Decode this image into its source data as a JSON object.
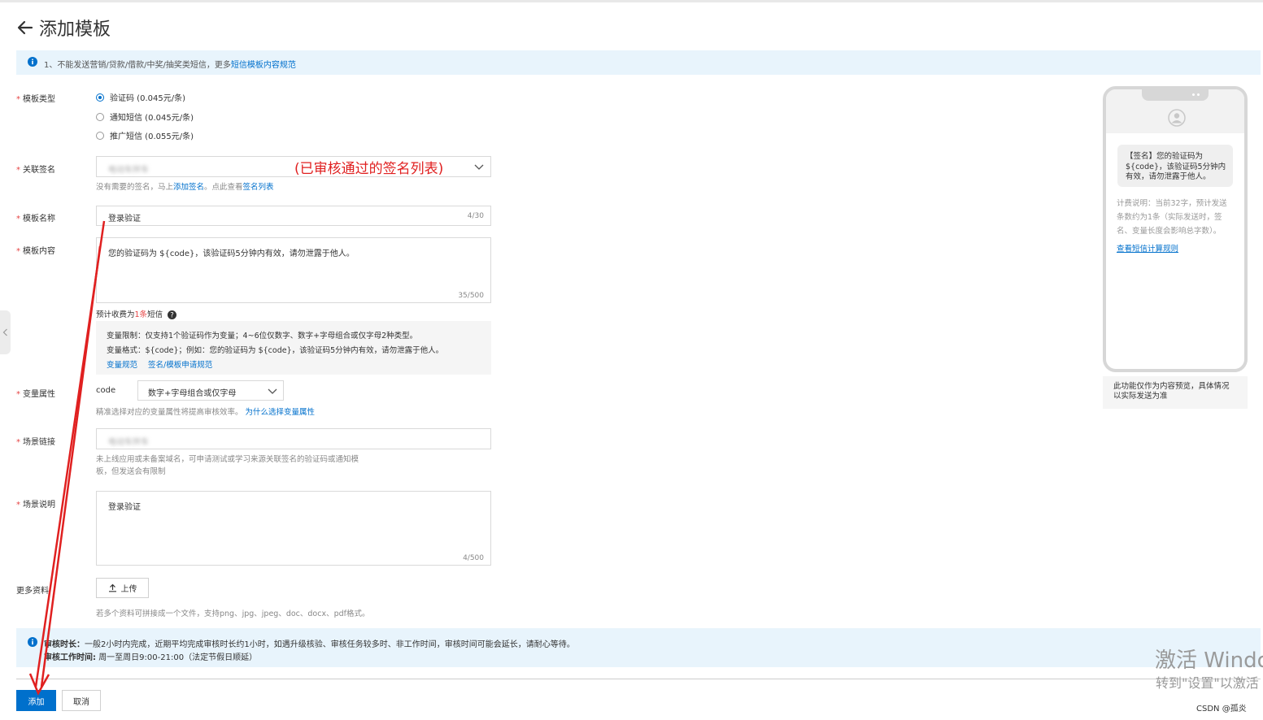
{
  "header": {
    "title": "添加模板"
  },
  "notice_top": {
    "text": "1、不能发送营销/贷款/借款/中奖/抽奖类短信，更多",
    "link": "短信模板内容规范"
  },
  "template_type": {
    "label": "模板类型",
    "options": [
      {
        "label": "验证码 (0.045元/条)",
        "checked": true
      },
      {
        "label": "通知短信 (0.045元/条)",
        "checked": false
      },
      {
        "label": "推广短信 (0.055元/条)",
        "checked": false
      }
    ]
  },
  "signature": {
    "label": "关联签名",
    "value": "电动车拌车",
    "help_prefix": "没有需要的签名，马上",
    "help_link1": "添加签名",
    "help_middle": "。点此查看",
    "help_link2": "签名列表",
    "annotation": "(已审核通过的签名列表)"
  },
  "template_name": {
    "label": "模板名称",
    "value": "登录验证",
    "counter": "4/30"
  },
  "template_content": {
    "label": "模板内容",
    "value": "您的验证码为 ${code}，该验证码5分钟内有效，请勿泄露于他人。",
    "counter": "35/500",
    "estimate_prefix": "预计收费为",
    "estimate_count": "1条",
    "estimate_suffix": "短信"
  },
  "variable_box": {
    "limit_label": "变量限制：",
    "limit_text": "仅支持1个验证码作为变量；4~6位仅数字、数字+字母组合或仅字母2种类型。",
    "format_label": "变量格式：",
    "format_text": "${code}；例如：您的验证码为 ${code}，该验证码5分钟内有效，请勿泄露于他人。",
    "link1": "变量规范",
    "link2": "签名/模板申请规范"
  },
  "variable_attr": {
    "label": "变量属性",
    "var_name": "code",
    "select_value": "数字+字母组合或仅字母",
    "help": "精准选择对应的变量属性将提高审核效率。",
    "help_link": "为什么选择变量属性"
  },
  "scene_link": {
    "label": "场景链接",
    "value": "电动车拌车",
    "help_line1": "未上线应用或未备案域名，可申请测试或学习来源关联签名的验证码或通知模",
    "help_line2": "板，但发送会有限制"
  },
  "scene_desc": {
    "label": "场景说明",
    "value": "登录验证",
    "counter": "4/500"
  },
  "more_info": {
    "label": "更多资料",
    "upload_label": "上传",
    "help": "若多个资料可拼接成一个文件，支持png、jpg、jpeg、doc、docx、pdf格式。"
  },
  "notice_bottom": {
    "line1_label": "审核时长：",
    "line1_text": "一般2小时内完成，近期平均完成审核时长约1小时，如遇升级核验、审核任务较多时、非工作时间，审核时间可能会延长，请耐心等待。",
    "line2_label": "审核工作时间:",
    "line2_text": "周一至周日9:00-21:00（法定节假日顺延）"
  },
  "buttons": {
    "add": "添加",
    "cancel": "取消"
  },
  "preview": {
    "bubble_line1": "【签名】您的验证码为",
    "bubble_line2": "${code}，该验证码5分钟内",
    "bubble_line3": "有效，请勿泄露于他人。",
    "desc_line1": "计费说明：当前32字，预计发送",
    "desc_line2": "条数约为1条（实际发送时，签",
    "desc_line3": "名、变量长度会影响总字数）。",
    "link": "查看短信计算规则",
    "note_line1": "此功能仅作为内容预览，具体情况",
    "note_line2": "以实际发送为准"
  },
  "watermark": {
    "line1": "激活 Windo",
    "line2": "转到\"设置\"以激活"
  },
  "credit": "CSDN @孤炎",
  "colors": {
    "primary": "#0070cc",
    "required": "#e64545",
    "annotation": "#e02020",
    "notice_bg": "#e8f4fc"
  }
}
